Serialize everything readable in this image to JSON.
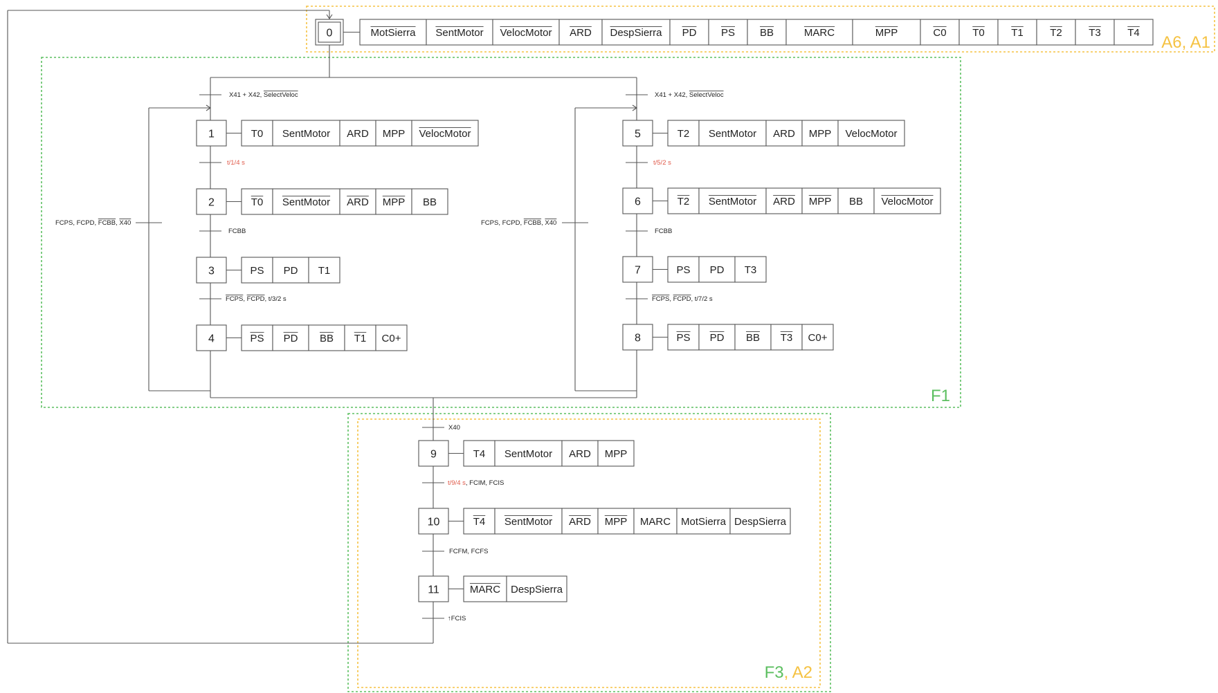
{
  "colors": {
    "green": "#5cbf60",
    "orange": "#f5c242",
    "red": "#e05a4a",
    "line": "#555555"
  },
  "zones": {
    "a6a1": {
      "label": "A6, A1"
    },
    "f1": {
      "label": "F1"
    },
    "f3a2": {
      "label_f3": "F3",
      "label_sep": ", ",
      "label_a2": "A2"
    }
  },
  "steps": [
    {
      "num": "0",
      "initial": true,
      "actions": [
        {
          "text": "MotSierra",
          "neg": true
        },
        {
          "text": "SentMotor",
          "neg": true
        },
        {
          "text": "VelocMotor",
          "neg": true
        },
        {
          "text": "ARD",
          "neg": true
        },
        {
          "text": "DespSierra",
          "neg": true
        },
        {
          "text": "PD",
          "neg": true
        },
        {
          "text": "PS",
          "neg": true
        },
        {
          "text": "BB",
          "neg": true
        },
        {
          "text": "MARC",
          "neg": true
        },
        {
          "text": "MPP",
          "neg": true
        },
        {
          "text": "C0",
          "neg": true
        },
        {
          "text": "T0",
          "neg": true
        },
        {
          "text": "T1",
          "neg": true
        },
        {
          "text": "T2",
          "neg": true
        },
        {
          "text": "T3",
          "neg": true
        },
        {
          "text": "T4",
          "neg": true
        }
      ]
    },
    {
      "num": "1",
      "actions": [
        {
          "text": "T0"
        },
        {
          "text": "SentMotor"
        },
        {
          "text": "ARD"
        },
        {
          "text": "MPP"
        },
        {
          "text": "VelocMotor",
          "neg": true
        }
      ]
    },
    {
      "num": "2",
      "actions": [
        {
          "text": "T0",
          "neg": true
        },
        {
          "text": "SentMotor",
          "neg": true
        },
        {
          "text": "ARD",
          "neg": true
        },
        {
          "text": "MPP",
          "neg": true
        },
        {
          "text": "BB"
        }
      ]
    },
    {
      "num": "3",
      "actions": [
        {
          "text": "PS"
        },
        {
          "text": "PD"
        },
        {
          "text": "T1"
        }
      ]
    },
    {
      "num": "4",
      "actions": [
        {
          "text": "PS",
          "neg": true
        },
        {
          "text": "PD",
          "neg": true
        },
        {
          "text": "BB",
          "neg": true
        },
        {
          "text": "T1",
          "neg": true
        },
        {
          "text": "C0+"
        }
      ]
    },
    {
      "num": "5",
      "actions": [
        {
          "text": "T2"
        },
        {
          "text": "SentMotor"
        },
        {
          "text": "ARD"
        },
        {
          "text": "MPP"
        },
        {
          "text": "VelocMotor"
        }
      ]
    },
    {
      "num": "6",
      "actions": [
        {
          "text": "T2",
          "neg": true
        },
        {
          "text": "SentMotor",
          "neg": true
        },
        {
          "text": "ARD",
          "neg": true
        },
        {
          "text": "MPP",
          "neg": true
        },
        {
          "text": "BB"
        },
        {
          "text": "VelocMotor",
          "neg": true
        }
      ]
    },
    {
      "num": "7",
      "actions": [
        {
          "text": "PS"
        },
        {
          "text": "PD"
        },
        {
          "text": "T3"
        }
      ]
    },
    {
      "num": "8",
      "actions": [
        {
          "text": "PS",
          "neg": true
        },
        {
          "text": "PD",
          "neg": true
        },
        {
          "text": "BB",
          "neg": true
        },
        {
          "text": "T3",
          "neg": true
        },
        {
          "text": "C0+"
        }
      ]
    },
    {
      "num": "9",
      "actions": [
        {
          "text": "T4"
        },
        {
          "text": "SentMotor"
        },
        {
          "text": "ARD"
        },
        {
          "text": "MPP"
        }
      ]
    },
    {
      "num": "10",
      "actions": [
        {
          "text": "T4",
          "neg": true
        },
        {
          "text": "SentMotor",
          "neg": true
        },
        {
          "text": "ARD",
          "neg": true
        },
        {
          "text": "MPP",
          "neg": true
        },
        {
          "text": "MARC"
        },
        {
          "text": "MotSierra"
        },
        {
          "text": "DespSierra"
        }
      ]
    },
    {
      "num": "11",
      "actions": [
        {
          "text": "MARC",
          "neg": true
        },
        {
          "text": "DespSierra"
        }
      ]
    }
  ],
  "transitions": {
    "to1": [
      {
        "t": "X41 + X42, "
      },
      {
        "t": "SelectVeloc",
        "neg": true
      }
    ],
    "to5": [
      {
        "t": "X41 + X42, "
      },
      {
        "t": "SelectVeloc",
        "neg": true
      }
    ],
    "t1_2": [
      {
        "t": "t/1/4 s",
        "red": true
      }
    ],
    "t2_3": [
      {
        "t": "FCBB"
      }
    ],
    "t3_4": [
      {
        "t": "FCPS",
        "neg": true
      },
      {
        "t": ", "
      },
      {
        "t": "FCPD",
        "neg": true
      },
      {
        "t": ", t/3/2 s"
      }
    ],
    "loop_left": [
      {
        "t": "FCPS, FCPD, "
      },
      {
        "t": "FCBB",
        "neg": true
      },
      {
        "t": ", "
      },
      {
        "t": "X40",
        "neg": true
      }
    ],
    "t5_6": [
      {
        "t": "t/5/2 s",
        "red": true
      }
    ],
    "t6_7": [
      {
        "t": "FCBB"
      }
    ],
    "t7_8": [
      {
        "t": "FCPS",
        "neg": true
      },
      {
        "t": ", "
      },
      {
        "t": "FCPD",
        "neg": true
      },
      {
        "t": ", t/7/2 s"
      }
    ],
    "loop_right": [
      {
        "t": "FCPS, FCPD, "
      },
      {
        "t": "FCBB",
        "neg": true
      },
      {
        "t": ", "
      },
      {
        "t": "X40",
        "neg": true
      }
    ],
    "to9": [
      {
        "t": "X40"
      }
    ],
    "t9_10": [
      {
        "t": "t/9/4 s",
        "red": true
      },
      {
        "t": ", FCIM, FCIS"
      }
    ],
    "t10_11": [
      {
        "t": "FCFM, FCFS"
      }
    ],
    "t11_0": [
      {
        "t": "↑FCIS"
      }
    ]
  }
}
